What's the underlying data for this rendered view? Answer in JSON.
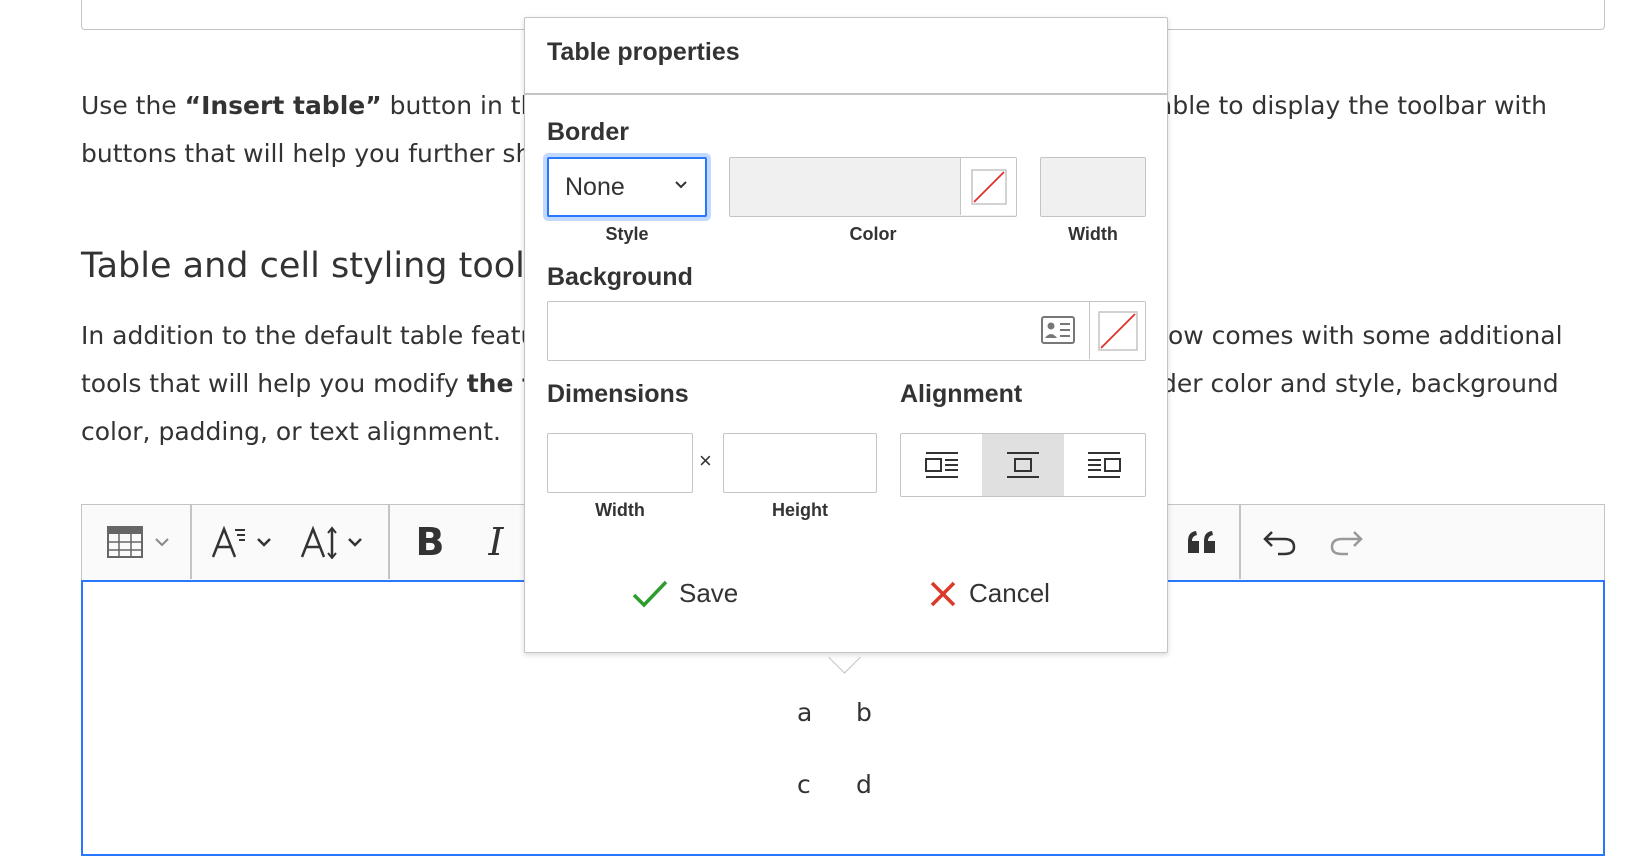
{
  "document": {
    "para1": {
      "line1_a": "Use the ",
      "line1_bold": "“Insert table”",
      "line1_b": " button in the",
      "line1_right": "able to display the toolbar with",
      "line2": "buttons that will help you further sh"
    },
    "heading": "Table and cell styling tools",
    "para2": {
      "line1_left": "In addition to the default table featu",
      "line1_right": "low comes with some additional",
      "line2_left": "tools that will help you modify ",
      "line2_bold": "the t",
      "line2_right": "der color and style, background",
      "line3": "color, padding, or text alignment."
    }
  },
  "editor": {
    "cells": [
      "a",
      "b",
      "c",
      "d"
    ]
  },
  "dialog": {
    "title": "Table properties",
    "border_label": "Border",
    "border_style_value": "None",
    "style_sub": "Style",
    "color_sub": "Color",
    "width_sub": "Width",
    "background_label": "Background",
    "dimensions_label": "Dimensions",
    "times_sign": "×",
    "dim_width_sub": "Width",
    "dim_height_sub": "Height",
    "alignment_label": "Alignment",
    "save_label": "Save",
    "cancel_label": "Cancel",
    "colors": {
      "save_check": "#2e9c2e",
      "cancel_x": "#db3a28",
      "focus": "#2977ff"
    }
  }
}
